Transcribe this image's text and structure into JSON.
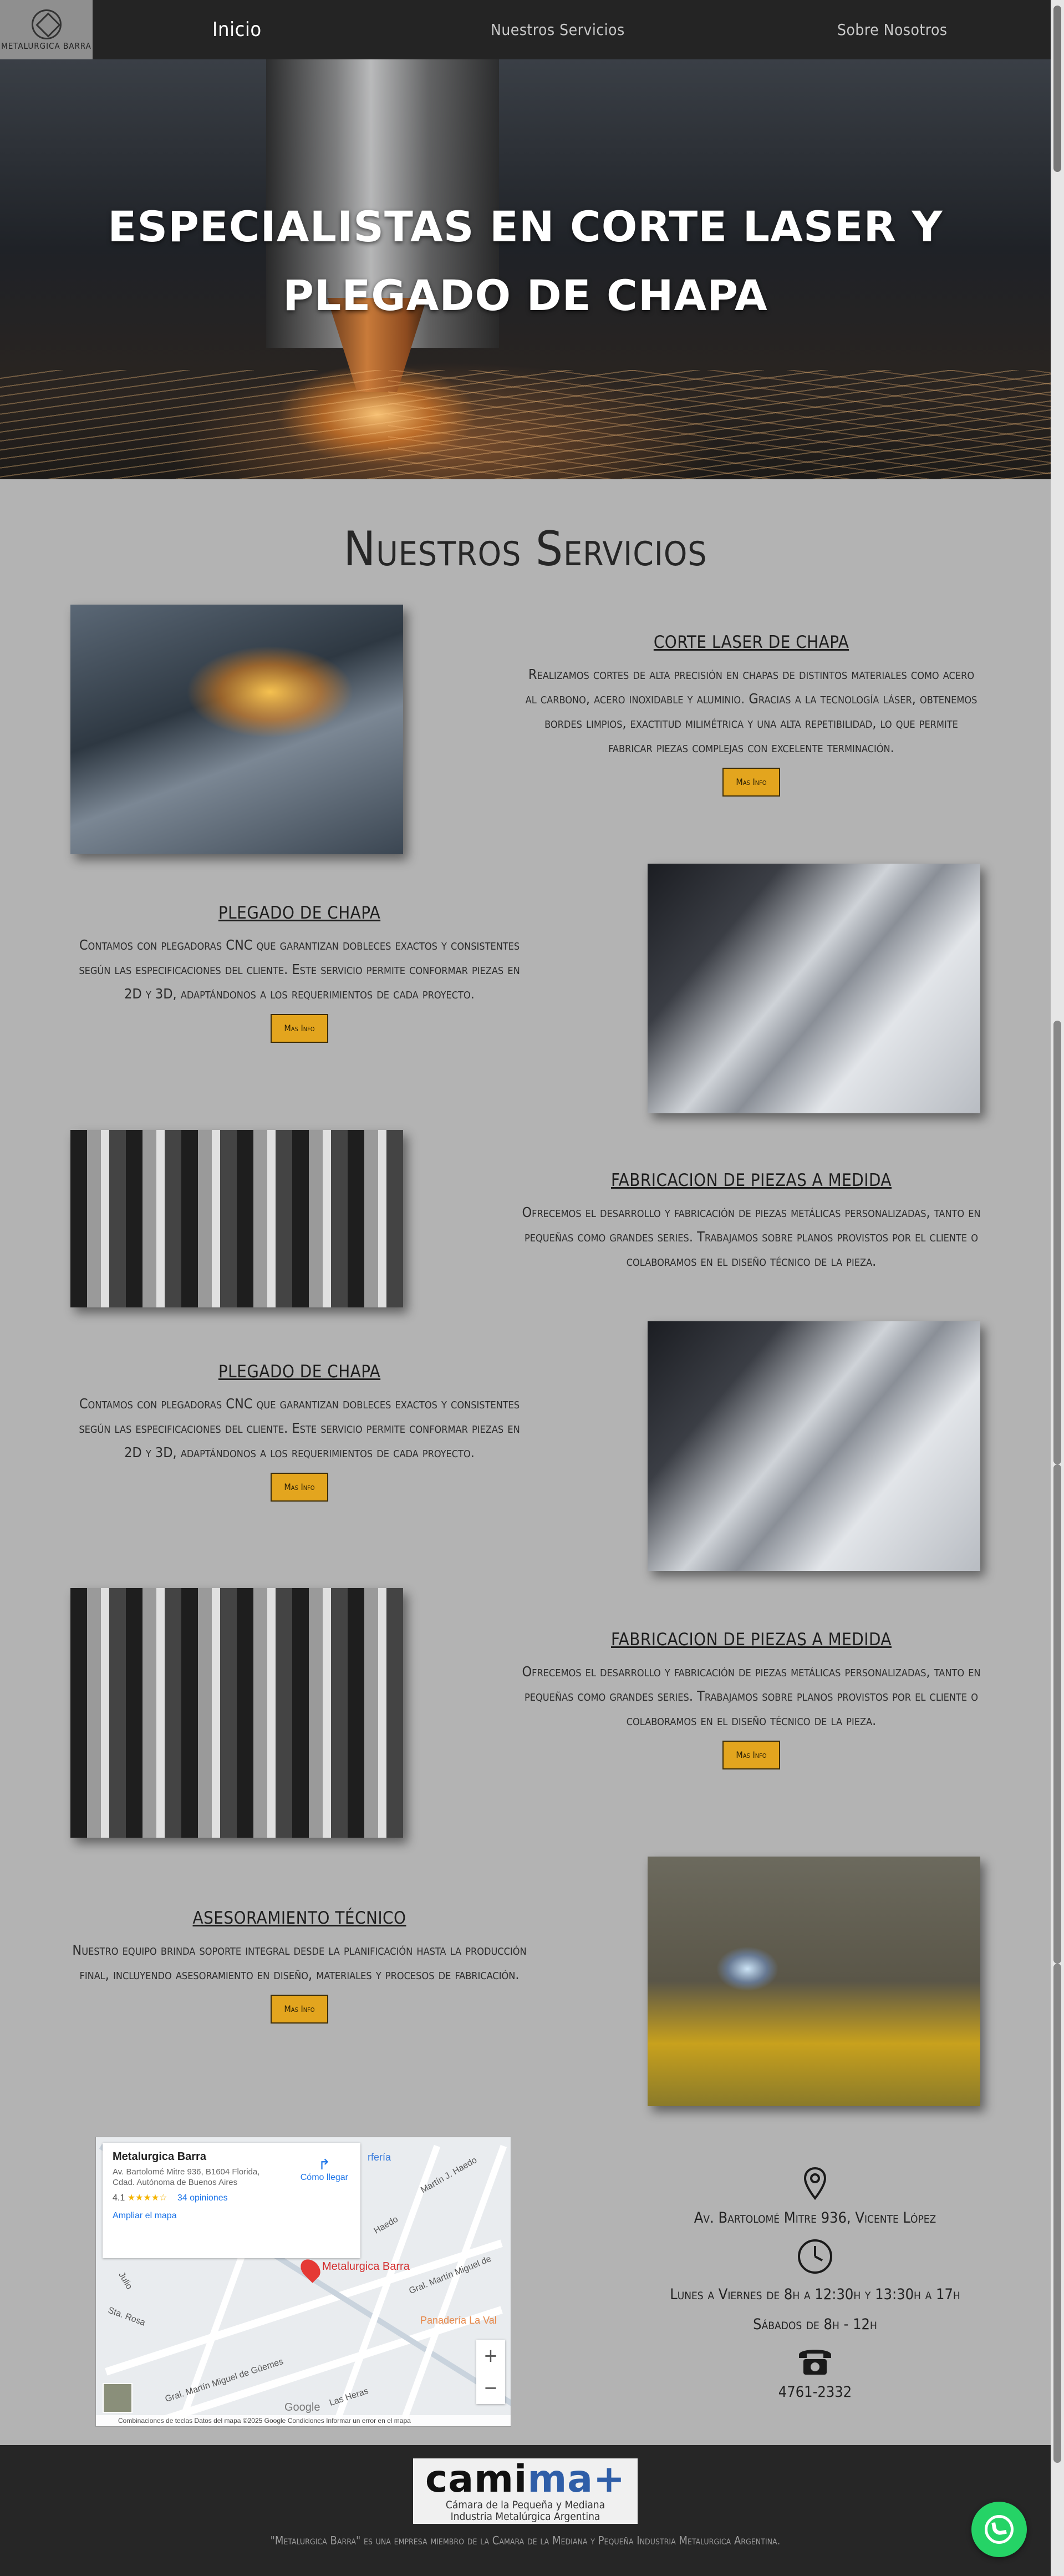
{
  "nav": {
    "logo_text": "METALURGICA BARRA",
    "items": [
      "Inicio",
      "Nuestros Servicios",
      "Sobre Nosotros"
    ]
  },
  "hero": {
    "line1": "ESPECIALISTAS EN CORTE LASER Y",
    "line2": "PLEGADO DE CHAPA"
  },
  "services_title": "Nuestros Servicios",
  "services": [
    {
      "title": "CORTE LASER DE CHAPA",
      "text": "Realizamos cortes de alta precisión en chapas de distintos materiales como acero al carbono, acero inoxidable y aluminio. Gracias a la tecnología láser, obtenemos bordes limpios, exactitud milimétrica y una alta repetibilidad, lo que permite fabricar piezas complejas con excelente terminación.",
      "button": "Mas Info"
    },
    {
      "title": "PLEGADO DE CHAPA",
      "text": "Contamos con plegadoras CNC que garantizan dobleces exactos y consistentes según las especificaciones del cliente. Este servicio permite conformar piezas en 2D y 3D, adaptándonos a los requerimientos de cada proyecto.",
      "button": "Mas Info"
    },
    {
      "title": "FABRICACION DE PIEZAS A MEDIDA",
      "text": "Ofrecemos el desarrollo y fabricación de piezas metálicas personalizadas, tanto en pequeñas como grandes series. Trabajamos sobre planos provistos por el cliente o colaboramos en el diseño técnico de la pieza."
    },
    {
      "title": "PLEGADO DE CHAPA",
      "text": "Contamos con plegadoras CNC que garantizan dobleces exactos y consistentes según las especificaciones del cliente. Este servicio permite conformar piezas en 2D y 3D, adaptándonos a los requerimientos de cada proyecto.",
      "button": "Mas Info"
    },
    {
      "title": "FABRICACION DE PIEZAS A MEDIDA",
      "text": "Ofrecemos el desarrollo y fabricación de piezas metálicas personalizadas, tanto en pequeñas como grandes series. Trabajamos sobre planos provistos por el cliente o colaboramos en el diseño técnico de la pieza.",
      "button": "Mas Info"
    },
    {
      "title": "ASESORAMIENTO TÉCNICO",
      "text": "Nuestro equipo brinda soporte integral desde la planificación hasta la producción final, incluyendo asesoramiento en diseño, materiales y procesos de fabricación.",
      "button": "Mas Info"
    }
  ],
  "map": {
    "place_name": "Metalurgica Barra",
    "address": "Av. Bartolomé Mitre 936, B1604 Florida, Cdad. Autónoma de Buenos Aires",
    "rating": "4.1",
    "stars": "★★★★☆",
    "reviews": "34 opiniones",
    "directions": "Cómo llegar",
    "enlarge": "Ampliar el mapa",
    "pin_label": "Metalurgica Barra",
    "poi": "Panadería La Val",
    "poi2": "rfería",
    "streets": [
      "Martín J. Haedo",
      "Gral. Martín Miguel de",
      "Sta. Rosa",
      "Gral. Martín Miguel de Güemes",
      "Haedo",
      "Las Heras",
      "Julio"
    ],
    "footer": "Combinaciones de teclas    Datos del mapa ©2025 Google    Condiciones    Informar un error en el mapa",
    "google": "Google"
  },
  "contact": {
    "address": "Av. Bartolomé Mitre 936, Vicente López",
    "hours1": "Lunes a Viernes de 8h a 12:30h y 13:30h a 17h",
    "hours2": "Sábados de 8h - 12h",
    "phone": "4761-2332"
  },
  "footer": {
    "camima_word_a": "cami",
    "camima_word_b": "ma+",
    "camima_sub1": "Cámara de la Pequeña y Mediana",
    "camima_sub2": "Industria Metalúrgica Argentina",
    "note": "\"Metalurgica Barra\" es una empresa miembro de la Camara de la Mediana y Pequeña Industria Metalurgica Argentina."
  }
}
